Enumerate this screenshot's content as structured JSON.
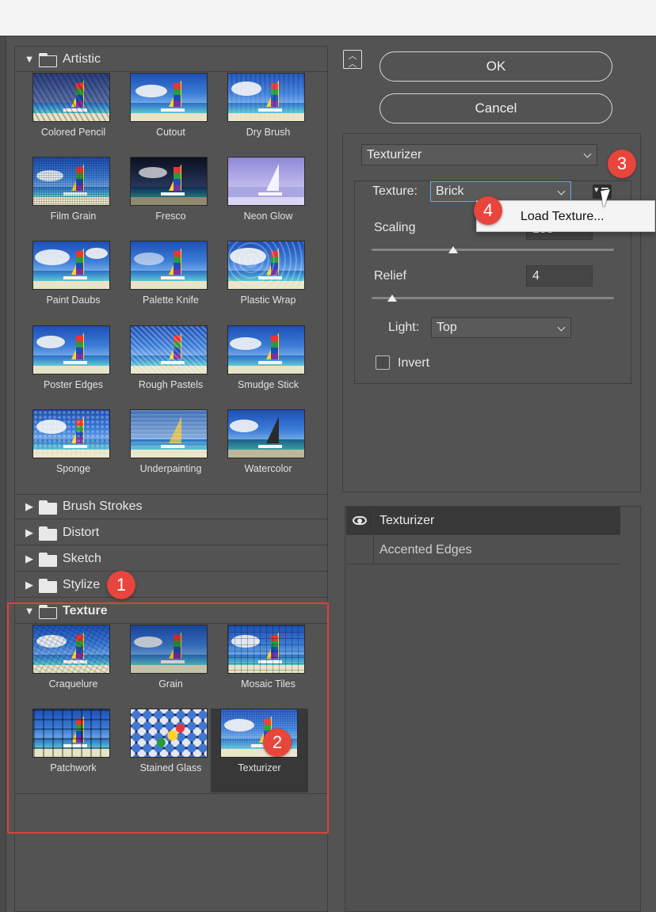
{
  "gallery": {
    "categories": [
      {
        "name": "Artistic",
        "expanded": true
      },
      {
        "name": "Brush Strokes",
        "expanded": false
      },
      {
        "name": "Distort",
        "expanded": false
      },
      {
        "name": "Sketch",
        "expanded": false
      },
      {
        "name": "Stylize",
        "expanded": false
      },
      {
        "name": "Texture",
        "expanded": true
      }
    ],
    "artistic_filters": [
      "Colored Pencil",
      "Cutout",
      "Dry Brush",
      "Film Grain",
      "Fresco",
      "Neon Glow",
      "Paint Daubs",
      "Palette Knife",
      "Plastic Wrap",
      "Poster Edges",
      "Rough Pastels",
      "Smudge Stick",
      "Sponge",
      "Underpainting",
      "Watercolor"
    ],
    "texture_filters": [
      "Craquelure",
      "Grain",
      "Mosaic Tiles",
      "Patchwork",
      "Stained Glass",
      "Texturizer"
    ],
    "selected_filter": "Texturizer"
  },
  "buttons": {
    "ok": "OK",
    "cancel": "Cancel"
  },
  "settings": {
    "filter_select": "Texturizer",
    "texture_label": "Texture:",
    "texture_value": "Brick",
    "load_texture": "Load Texture...",
    "scaling_label": "Scaling",
    "scaling_value": 100,
    "relief_label": "Relief",
    "relief_value": "4",
    "light_label": "Light:",
    "light_value": "Top",
    "invert_label": "Invert",
    "invert_checked": false
  },
  "layers": {
    "items": [
      {
        "name": "Texturizer",
        "visible": true,
        "active": true
      },
      {
        "name": "Accented Edges",
        "visible": false,
        "active": false
      }
    ]
  },
  "badges": [
    "1",
    "2",
    "3",
    "4"
  ],
  "colors": {
    "badge": "#e8453c",
    "highlight_box": "#d8443c",
    "panel_bg": "#535353",
    "focus_border": "#6ea6e8"
  }
}
